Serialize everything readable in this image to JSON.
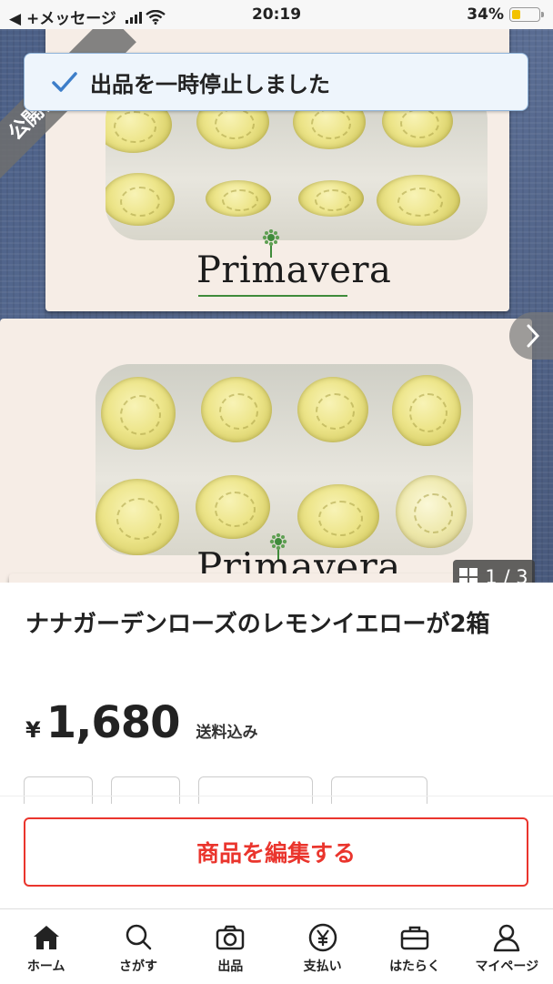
{
  "status_bar": {
    "back_label": "◀ +メッセージ",
    "time": "20:19",
    "battery": "34%",
    "battery_level": 0.34
  },
  "photo": {
    "brand_text": "Primavera",
    "public_label": "公開停止中",
    "counter": "1 / 3"
  },
  "toast": {
    "message": "出品を一時停止しました"
  },
  "product": {
    "title": "ナナガーデンローズのレモンイエローが2箱",
    "currency": "¥",
    "price": "1,680",
    "shipping": "送料込み"
  },
  "actions": {
    "edit_label": "商品を編集する"
  },
  "tabs": [
    {
      "label": "ホーム",
      "icon": "home-icon"
    },
    {
      "label": "さがす",
      "icon": "search-icon"
    },
    {
      "label": "出品",
      "icon": "camera-icon"
    },
    {
      "label": "支払い",
      "icon": "yen-icon"
    },
    {
      "label": "はたらく",
      "icon": "briefcase-icon"
    },
    {
      "label": "マイページ",
      "icon": "person-icon"
    }
  ],
  "colors": {
    "accent_red": "#ea352d",
    "toast_bg": "#eef5fc",
    "check_blue": "#3d7ec9"
  }
}
